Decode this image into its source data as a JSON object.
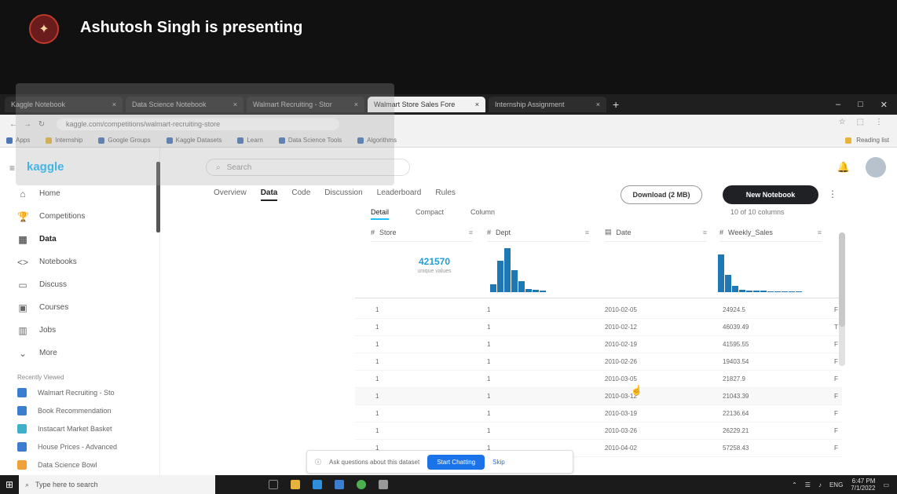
{
  "presenter": {
    "text": "Ashutosh Singh is presenting",
    "avatar_icon": "logo-emblem"
  },
  "browser": {
    "tabs": [
      {
        "label": "Kaggle Notebook"
      },
      {
        "label": "Data Science Notebook"
      },
      {
        "label": "Walmart Recruiting - Stor"
      },
      {
        "label": "Walmart Store Sales Fore",
        "active": true
      },
      {
        "label": "Internship Assignment"
      }
    ],
    "url": "kaggle.com/competitions/walmart-recruiting-store",
    "bookmarks": [
      "Apps",
      "Internship",
      "Google Groups",
      "Kaggle Datasets",
      "Learn",
      "Data Science Tools",
      "Algorithms",
      "Reading list"
    ],
    "window_controls": [
      "–",
      "□",
      "✕"
    ]
  },
  "kaggle": {
    "logo": "kaggle",
    "search_placeholder": "Search",
    "nav": [
      {
        "label": "Home",
        "icon": "⌂"
      },
      {
        "label": "Competitions",
        "icon": "🏆"
      },
      {
        "label": "Data",
        "icon": "▦",
        "active": true
      },
      {
        "label": "Notebooks",
        "icon": "<>"
      },
      {
        "label": "Discuss",
        "icon": "▭"
      },
      {
        "label": "Courses",
        "icon": "▣"
      },
      {
        "label": "Jobs",
        "icon": "▥"
      },
      {
        "label": "More",
        "icon": "⌄"
      }
    ],
    "recent_heading": "Recently Viewed",
    "recent": [
      {
        "label": "Walmart Recruiting - Sto"
      },
      {
        "label": "Book Recommendation"
      },
      {
        "label": "Instacart Market Basket"
      },
      {
        "label": "House Prices - Advanced"
      },
      {
        "label": "Data Science Bowl"
      }
    ],
    "detail_tabs": [
      {
        "label": "Data",
        "active": true
      },
      {
        "label": "Rules"
      },
      {
        "label": "Overview"
      },
      {
        "label": "Discussion"
      },
      {
        "label": "Leaderboard"
      },
      {
        "label": "Code"
      }
    ],
    "download_btn": "Download (2 MB)",
    "new_notebook_btn": "New Notebook",
    "sub_tabs": [
      {
        "label": "Detail",
        "active": true
      },
      {
        "label": "Compact"
      },
      {
        "label": "Column"
      }
    ],
    "view_select": "10 of 10 columns",
    "columns": [
      {
        "name": "Store"
      },
      {
        "name": "Dept"
      },
      {
        "name": "Date"
      },
      {
        "name": "Weekly_Sales"
      }
    ],
    "summary": {
      "count": "421570",
      "count_sub": "unique values"
    },
    "rows": [
      {
        "c1": "1",
        "c2": "1",
        "c3": "2010-02-05",
        "c4": "24924.5",
        "c5": "F"
      },
      {
        "c1": "1",
        "c2": "1",
        "c3": "2010-02-12",
        "c4": "46039.49",
        "c5": "T"
      },
      {
        "c1": "1",
        "c2": "1",
        "c3": "2010-02-19",
        "c4": "41595.55",
        "c5": "F"
      },
      {
        "c1": "1",
        "c2": "1",
        "c3": "2010-02-26",
        "c4": "19403.54",
        "c5": "F"
      },
      {
        "c1": "1",
        "c2": "1",
        "c3": "2010-03-05",
        "c4": "21827.9",
        "c5": "F"
      },
      {
        "c1": "1",
        "c2": "1",
        "c3": "2010-03-12",
        "c4": "21043.39",
        "c5": "F"
      },
      {
        "c1": "1",
        "c2": "1",
        "c3": "2010-03-19",
        "c4": "22136.64",
        "c5": "F"
      },
      {
        "c1": "1",
        "c2": "1",
        "c3": "2010-03-26",
        "c4": "26229.21",
        "c5": "F"
      },
      {
        "c1": "1",
        "c2": "1",
        "c3": "2010-04-02",
        "c4": "57258.43",
        "c5": "F"
      }
    ],
    "toast": {
      "text": "Ask questions about this dataset",
      "btn": "Start Chatting",
      "close": "Skip"
    }
  },
  "taskbar": {
    "search": "Type here to search",
    "icons": [
      {
        "name": "task-view-icon",
        "color": "#888888"
      },
      {
        "name": "file-explorer-icon",
        "color": "#e8b33a"
      },
      {
        "name": "edge-icon",
        "color": "#2f8fdd"
      },
      {
        "name": "mail-icon",
        "color": "#3b7ed0"
      },
      {
        "name": "chrome-icon",
        "color": "#4caf50"
      },
      {
        "name": "settings-icon",
        "color": "#999999"
      }
    ],
    "time": "6:47 PM",
    "date": "7/1/2022",
    "lang": "ENG"
  }
}
